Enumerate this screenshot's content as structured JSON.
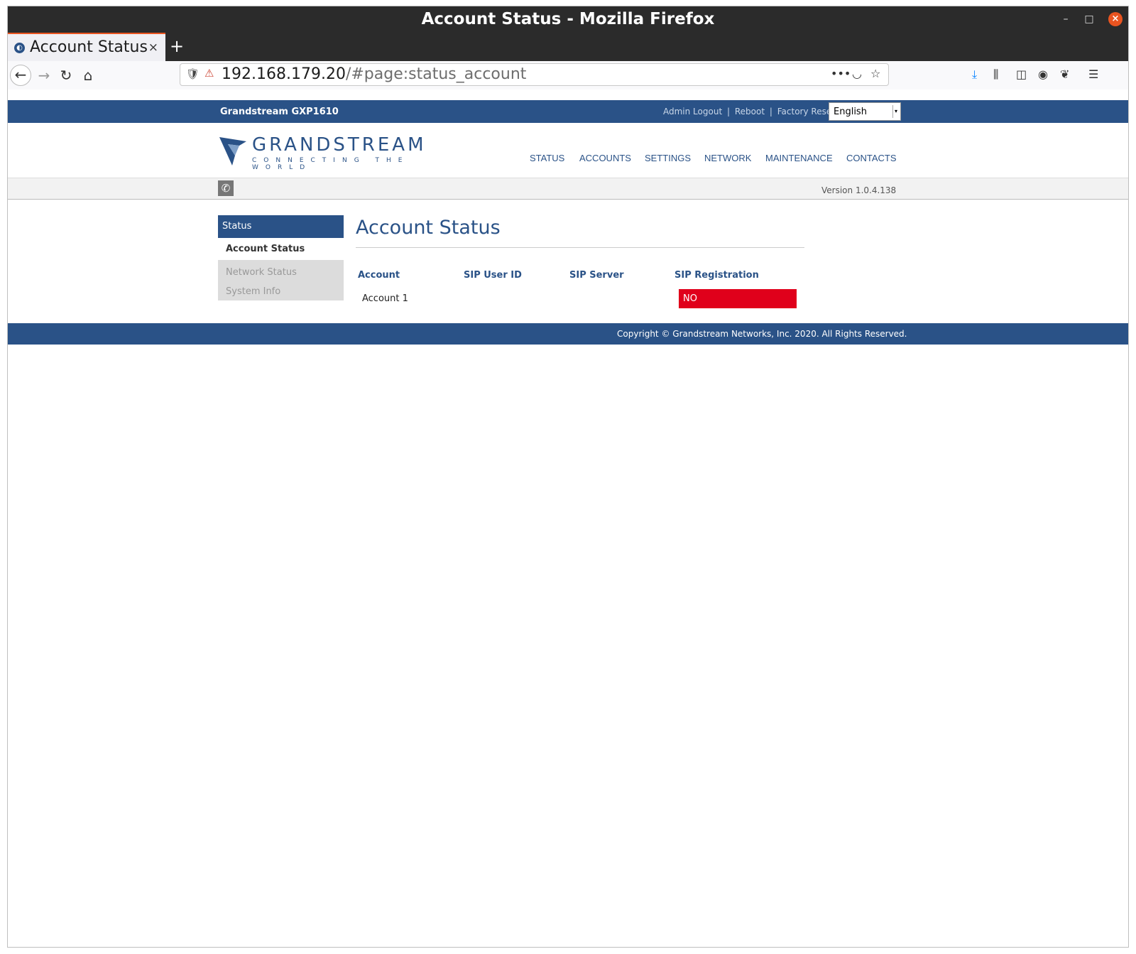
{
  "window": {
    "title": "Account Status - Mozilla Firefox"
  },
  "tab": {
    "title": "Account Status",
    "close": "×",
    "new": "+"
  },
  "urlbar": {
    "host": "192.168.179.20",
    "path": "/#page:status_account"
  },
  "device": {
    "model": "Grandstream GXP1610"
  },
  "toplinks": {
    "logout": "Admin Logout",
    "reboot": "Reboot",
    "factory_reset": "Factory Reset",
    "separator": "|"
  },
  "language": {
    "selected": "English"
  },
  "logo": {
    "brand": "GRANDSTREAM",
    "tagline": "CONNECTING THE WORLD"
  },
  "nav": [
    "STATUS",
    "ACCOUNTS",
    "SETTINGS",
    "NETWORK",
    "MAINTENANCE",
    "CONTACTS"
  ],
  "version": "Version 1.0.4.138",
  "sidebar": {
    "section": "Status",
    "items": [
      "Account Status",
      "Network Status",
      "System Info"
    ]
  },
  "content": {
    "title": "Account Status",
    "columns": [
      "Account",
      "SIP User ID",
      "SIP Server",
      "SIP Registration"
    ],
    "rows": [
      {
        "account": "Account 1",
        "sip_user_id": "",
        "sip_server": "",
        "registration": "NO"
      }
    ]
  },
  "footer": {
    "copyright": "Copyright © Grandstream Networks, Inc. 2020. All Rights Reserved."
  },
  "colors": {
    "brand_blue": "#2a5287",
    "registration_no": "#e0001b",
    "firefox_accent": "#e95420"
  }
}
